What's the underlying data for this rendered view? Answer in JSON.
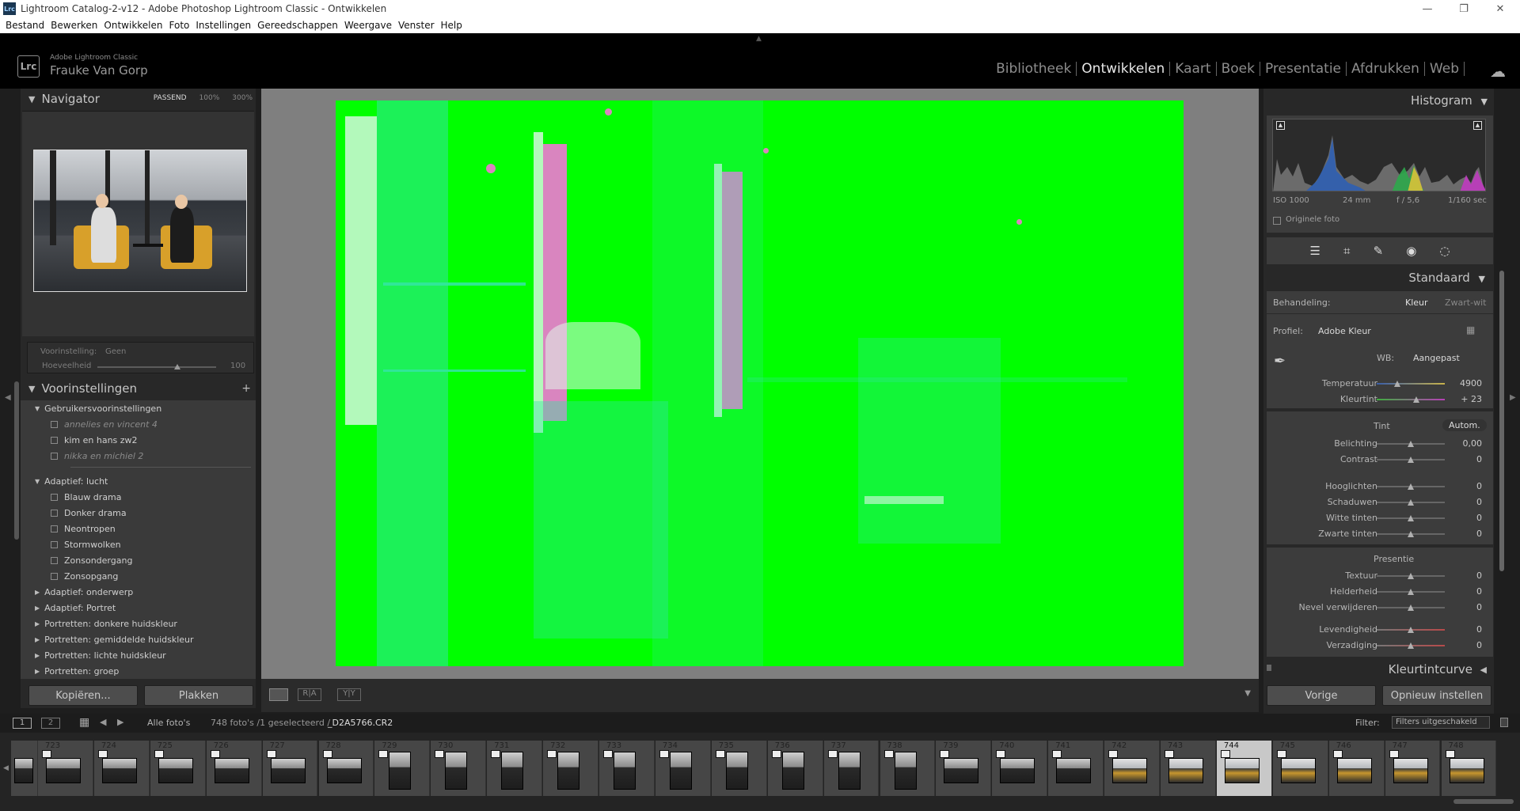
{
  "window": {
    "title": "Lightroom Catalog-2-v12 - Adobe Photoshop Lightroom Classic - Ontwikkelen",
    "app_badge": "Lrc"
  },
  "menu": [
    "Bestand",
    "Bewerken",
    "Ontwikkelen",
    "Foto",
    "Instellingen",
    "Gereedschappen",
    "Weergave",
    "Venster",
    "Help"
  ],
  "identity": {
    "product": "Adobe Lightroom Classic",
    "user": "Frauke Van Gorp",
    "logo": "Lrc"
  },
  "modules": [
    {
      "label": "Bibliotheek",
      "active": false
    },
    {
      "label": "Ontwikkelen",
      "active": true
    },
    {
      "label": "Kaart",
      "active": false
    },
    {
      "label": "Boek",
      "active": false
    },
    {
      "label": "Presentatie",
      "active": false
    },
    {
      "label": "Afdrukken",
      "active": false
    },
    {
      "label": "Web",
      "active": false
    }
  ],
  "navigator": {
    "title": "Navigator",
    "zoom_options": [
      "PASSEND",
      "100%",
      "300%"
    ]
  },
  "preset_amount": {
    "voorinstelling_label": "Voorinstelling:",
    "voorinstelling_value": "Geen",
    "hoeveelheid_label": "Hoeveelheid",
    "hoeveelheid_value": "100",
    "amount_fraction": 0.5
  },
  "presets": {
    "title": "Voorinstellingen",
    "items": [
      {
        "label": "Gebruikersvoorinstellingen",
        "type": "group",
        "open": true
      },
      {
        "label": "annelies en vincent 4",
        "type": "preset",
        "dim": true
      },
      {
        "label": "kim en hans zw2",
        "type": "preset",
        "dim": false
      },
      {
        "label": "nikka en michiel 2",
        "type": "preset",
        "dim": true
      },
      {
        "label": "Adaptief: lucht",
        "type": "group",
        "open": true
      },
      {
        "label": "Blauw drama",
        "type": "preset"
      },
      {
        "label": "Donker drama",
        "type": "preset"
      },
      {
        "label": "Neontropen",
        "type": "preset"
      },
      {
        "label": "Stormwolken",
        "type": "preset"
      },
      {
        "label": "Zonsondergang",
        "type": "preset"
      },
      {
        "label": "Zonsopgang",
        "type": "preset"
      },
      {
        "label": "Adaptief: onderwerp",
        "type": "group",
        "open": false
      },
      {
        "label": "Adaptief: Portret",
        "type": "group",
        "open": false
      },
      {
        "label": "Portretten: donkere huidskleur",
        "type": "group",
        "open": false
      },
      {
        "label": "Portretten: gemiddelde huidskleur",
        "type": "group",
        "open": false
      },
      {
        "label": "Portretten: lichte huidskleur",
        "type": "group",
        "open": false
      },
      {
        "label": "Portretten: groep",
        "type": "group",
        "open": false
      }
    ]
  },
  "left_buttons": {
    "copy": "Kopiëren...",
    "paste": "Plakken"
  },
  "histogram": {
    "title": "Histogram",
    "iso": "ISO 1000",
    "focal": "24 mm",
    "aperture": "f / 5,6",
    "shutter": "1/160 sec",
    "original_label": "Originele foto"
  },
  "basic": {
    "profile_section_title": "Standaard",
    "behandeling_label": "Behandeling:",
    "kleur": "Kleur",
    "zwartwit": "Zwart-wit",
    "profiel_label": "Profiel:",
    "profiel_value": "Adobe Kleur",
    "wb_label": "WB:",
    "wb_value": "Aangepast",
    "tint_header": "Tint",
    "auto": "Autom.",
    "presentie_header": "Presentie",
    "sliders": [
      {
        "label": "Temperatuur",
        "value": "4900",
        "pos": 0.3,
        "kind": "temp"
      },
      {
        "label": "Kleurtint",
        "value": "+ 23",
        "pos": 0.58,
        "kind": "tint"
      },
      {
        "label": "Belichting",
        "value": "0,00",
        "pos": 0.5
      },
      {
        "label": "Contrast",
        "value": "0",
        "pos": 0.5
      },
      {
        "label": "Hooglichten",
        "value": "0",
        "pos": 0.5
      },
      {
        "label": "Schaduwen",
        "value": "0",
        "pos": 0.5
      },
      {
        "label": "Witte tinten",
        "value": "0",
        "pos": 0.5
      },
      {
        "label": "Zwarte tinten",
        "value": "0",
        "pos": 0.5
      },
      {
        "label": "Textuur",
        "value": "0",
        "pos": 0.5
      },
      {
        "label": "Helderheid",
        "value": "0",
        "pos": 0.5
      },
      {
        "label": "Nevel verwijderen",
        "value": "0",
        "pos": 0.5
      },
      {
        "label": "Levendigheid",
        "value": "0",
        "pos": 0.5,
        "kind": "sat"
      },
      {
        "label": "Verzadiging",
        "value": "0",
        "pos": 0.5,
        "kind": "sat"
      }
    ],
    "next_section": "Kleurtintcurve"
  },
  "right_buttons": {
    "prev": "Vorige",
    "reset": "Opnieuw instellen"
  },
  "filmbar": {
    "screen1": "1",
    "screen2": "2",
    "source": "Alle foto's",
    "count": "748 foto's /1 geselecteerd /",
    "filename": "_D2A5766.CR2",
    "filter_label": "Filter:",
    "filter_value": "Filters uitgeschakeld"
  },
  "film": {
    "numbers": [
      "723",
      "724",
      "725",
      "726",
      "727",
      "728",
      "729",
      "730",
      "731",
      "732",
      "733",
      "734",
      "735",
      "736",
      "737",
      "738",
      "739",
      "740",
      "741",
      "742",
      "743",
      "744",
      "745",
      "746",
      "747",
      "748"
    ],
    "selected": "744"
  }
}
